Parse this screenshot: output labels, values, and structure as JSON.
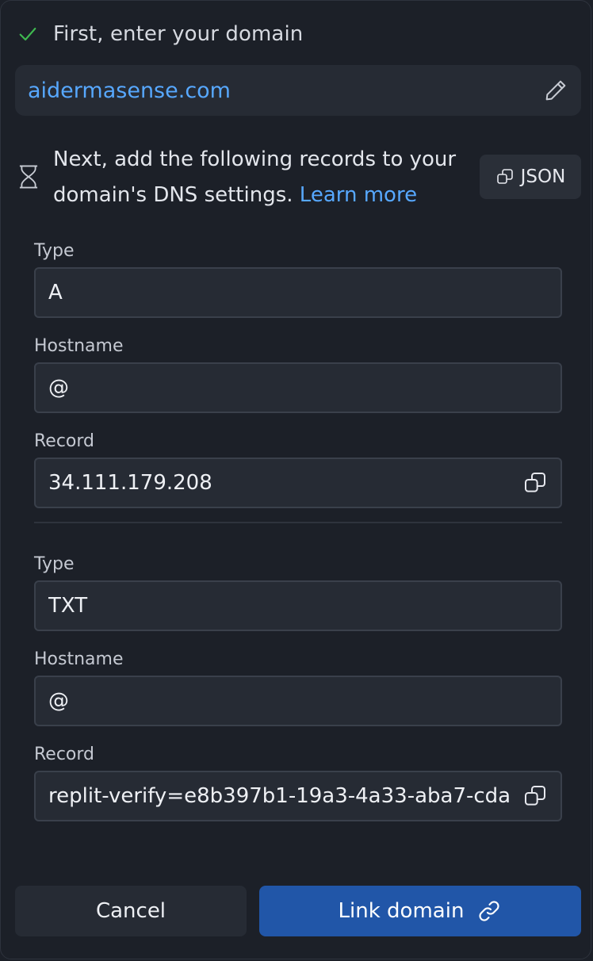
{
  "step1": {
    "title": "First, enter your domain",
    "domain": "aidermasense.com",
    "check_color": "#3fb950"
  },
  "step2": {
    "description": "Next, add the following records to your domain's DNS settings.",
    "learn_more": "Learn more",
    "json_button": "JSON"
  },
  "records": [
    {
      "type_label": "Type",
      "type_value": "A",
      "hostname_label": "Hostname",
      "hostname_value": "@",
      "record_label": "Record",
      "record_value": "34.111.179.208"
    },
    {
      "type_label": "Type",
      "type_value": "TXT",
      "hostname_label": "Hostname",
      "hostname_value": "@",
      "record_label": "Record",
      "record_value": "replit-verify=e8b397b1-19a3-4a33-aba7-cda"
    }
  ],
  "footer": {
    "cancel_label": "Cancel",
    "link_label": "Link domain",
    "link_color": "#2156a8"
  },
  "colors": {
    "accent": "#57a8ff",
    "background": "#1c2028",
    "field_bg": "#262b34"
  }
}
